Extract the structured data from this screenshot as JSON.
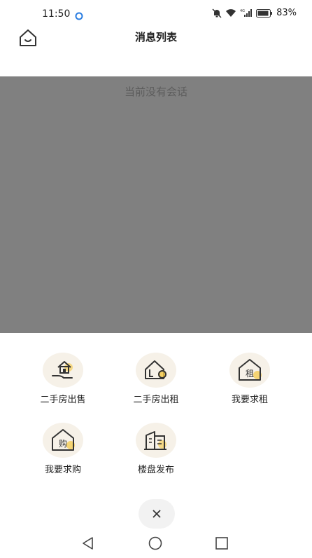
{
  "status_bar": {
    "time": "11:50",
    "battery": "83%",
    "network": "4G"
  },
  "header": {
    "title": "消息列表"
  },
  "overlay": {
    "empty_text": "当前没有会话"
  },
  "menu": {
    "items": [
      {
        "label": "二手房出售",
        "icon": "house-hand-icon"
      },
      {
        "label": "二手房出租",
        "icon": "house-refresh-icon"
      },
      {
        "label": "我要求租",
        "icon": "house-rent-icon",
        "glyph": "租"
      },
      {
        "label": "我要求购",
        "icon": "house-buy-icon",
        "glyph": "购"
      },
      {
        "label": "楼盘发布",
        "icon": "building-icon"
      }
    ]
  },
  "close_button": {
    "icon": "close-icon"
  },
  "nav": {
    "back_icon": "back-triangle-icon",
    "home_icon": "home-circle-icon",
    "recent_icon": "recent-square-icon"
  },
  "colors": {
    "overlay": "#808080",
    "accent": "#f5c842",
    "icon_bg": "#f6f1e8"
  }
}
